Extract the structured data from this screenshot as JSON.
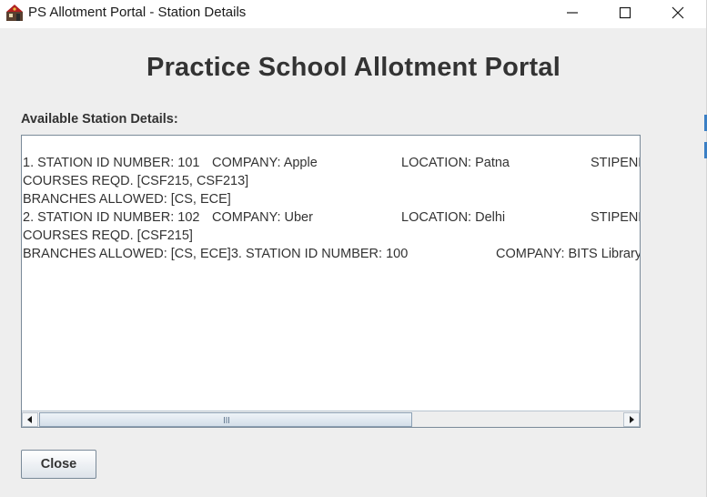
{
  "window": {
    "title": "PS Allotment Portal - Station Details"
  },
  "heading": "Practice School Allotment Portal",
  "section_label": "Available Station Details:",
  "text_lines": [
    {
      "segments": [
        "1. STATION ID NUMBER: 101",
        "COMPANY: Apple",
        "LOCATION: Patna",
        "STIPENE"
      ]
    },
    {
      "segments": [
        "COURSES REQD. [CSF215, CSF213]"
      ]
    },
    {
      "segments": [
        "BRANCHES ALLOWED: [CS, ECE]"
      ]
    },
    {
      "segments": [
        "2. STATION ID NUMBER: 102",
        "COMPANY: Uber",
        "LOCATION: Delhi",
        "STIPENE"
      ]
    },
    {
      "segments": [
        "COURSES REQD. [CSF215]"
      ]
    },
    {
      "segments": [
        "BRANCHES ALLOWED: [CS, ECE]3. STATION ID NUMBER: 100",
        "COMPANY: BITS Library"
      ]
    }
  ],
  "close_button_label": "Close",
  "scrollbar": {
    "thumb_fraction": 0.64,
    "position": 0.0
  },
  "colors": {
    "titlebar": "#ffffff",
    "window_bg": "#eeeeee",
    "text": "#333333",
    "panel_border": "#7a8a99"
  },
  "icons": [
    "app-icon",
    "minimize-icon",
    "maximize-icon",
    "close-icon",
    "arrow-left-icon",
    "arrow-right-icon",
    "scroll-grip-icon"
  ]
}
